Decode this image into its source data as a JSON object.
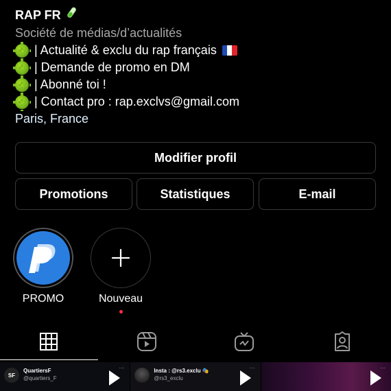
{
  "profile": {
    "name": "RAP FR",
    "category": "Société de médias/d’actualités",
    "bio_lines": [
      "| Actualité & exclu du rap français",
      "| Demande de promo en DM",
      "| Abonné toi !",
      "| Contact pro : rap.exclvs@gmail.com"
    ],
    "location": "Paris, France"
  },
  "buttons": {
    "edit": "Modifier profil",
    "promotions": "Promotions",
    "statistics": "Statistiques",
    "email": "E-mail"
  },
  "highlights": [
    {
      "label": "PROMO"
    },
    {
      "label": "Nouveau"
    }
  ],
  "tabs": [
    {
      "icon": "grid-icon",
      "active": true
    },
    {
      "icon": "reels-icon",
      "active": false
    },
    {
      "icon": "igtv-icon",
      "active": false
    },
    {
      "icon": "tagged-icon",
      "active": false
    }
  ],
  "thumbnails": [
    {
      "title": "QuartiersF",
      "handle": "@quartiers_F",
      "avatar_text": "SF"
    },
    {
      "title": "Insta : @rs3.exclu 🎭",
      "handle": "@rs3_exclu",
      "avatar_text": ""
    },
    {
      "title": "",
      "handle": "",
      "avatar_text": ""
    }
  ],
  "colors": {
    "background": "#000000",
    "muted_text": "#a8a8a8",
    "location_text": "#e0f1ff",
    "button_border": "#3a3a3a",
    "paypal_blue": "#2a7ee0",
    "notification_dot": "#ff3040"
  }
}
